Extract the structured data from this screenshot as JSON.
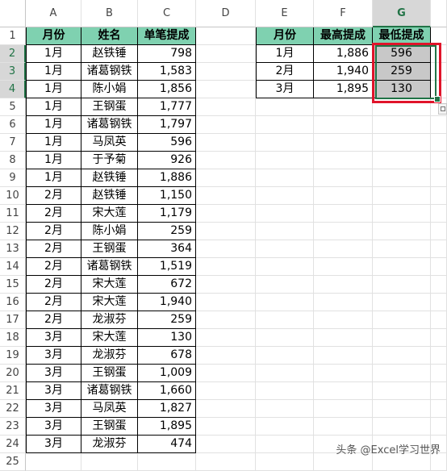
{
  "columns": [
    "A",
    "B",
    "C",
    "D",
    "E",
    "F",
    "G"
  ],
  "table1": {
    "headers": [
      "月份",
      "姓名",
      "单笔提成"
    ],
    "rows": [
      [
        "1月",
        "赵铁锤",
        "798"
      ],
      [
        "1月",
        "诸葛钢铁",
        "1,583"
      ],
      [
        "1月",
        "陈小娟",
        "1,856"
      ],
      [
        "1月",
        "王钢蛋",
        "1,777"
      ],
      [
        "1月",
        "诸葛钢铁",
        "1,797"
      ],
      [
        "1月",
        "马凤英",
        "596"
      ],
      [
        "1月",
        "于予菊",
        "926"
      ],
      [
        "1月",
        "赵铁锤",
        "1,886"
      ],
      [
        "2月",
        "赵铁锤",
        "1,150"
      ],
      [
        "2月",
        "宋大莲",
        "1,179"
      ],
      [
        "2月",
        "陈小娟",
        "259"
      ],
      [
        "2月",
        "王钢蛋",
        "364"
      ],
      [
        "2月",
        "诸葛钢铁",
        "1,519"
      ],
      [
        "2月",
        "宋大莲",
        "672"
      ],
      [
        "2月",
        "宋大莲",
        "1,940"
      ],
      [
        "2月",
        "龙淑芬",
        "259"
      ],
      [
        "3月",
        "宋大莲",
        "130"
      ],
      [
        "3月",
        "龙淑芬",
        "678"
      ],
      [
        "3月",
        "王钢蛋",
        "1,009"
      ],
      [
        "3月",
        "诸葛钢铁",
        "1,660"
      ],
      [
        "3月",
        "马凤英",
        "1,827"
      ],
      [
        "3月",
        "王钢蛋",
        "1,895"
      ],
      [
        "3月",
        "龙淑芬",
        "474"
      ]
    ]
  },
  "table2": {
    "headers": [
      "月份",
      "最高提成",
      "最低提成"
    ],
    "rows": [
      [
        "1月",
        "1,886",
        "596"
      ],
      [
        "2月",
        "1,940",
        "259"
      ],
      [
        "3月",
        "1,895",
        "130"
      ]
    ]
  },
  "row_numbers": [
    "1",
    "2",
    "3",
    "4",
    "5",
    "6",
    "7",
    "8",
    "9",
    "10",
    "11",
    "12",
    "13",
    "14",
    "15",
    "16",
    "17",
    "18",
    "19",
    "20",
    "21",
    "22",
    "23",
    "24",
    "25"
  ],
  "watermark": "头条 @Excel学习世界",
  "colors": {
    "header_fill": "#7fd1b0",
    "selection": "#217346",
    "highlight_box": "#e0142a"
  }
}
